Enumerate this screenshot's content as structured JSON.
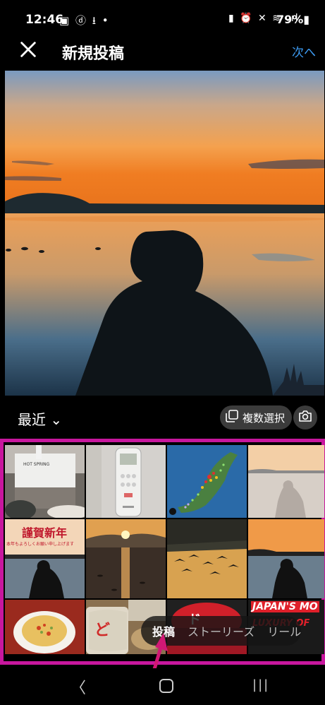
{
  "status_bar": {
    "time": "12:46",
    "left_icons": "▣ ⓓ ⭳ •",
    "right_icons": "▮ ⏰ ✕ ≋ .ıl",
    "battery": "79%▮"
  },
  "header": {
    "title": "新規投稿",
    "next_label": "次へ"
  },
  "album": {
    "label": "最近 ⌄",
    "multi_select_label": "複数選択"
  },
  "grid_texts": {
    "new_year": "謹賀新年",
    "new_year_sub": "本年もよろしくお願い申し上げます",
    "japans_most": "JAPAN'S MO",
    "luxury": "LUXURY OF",
    "hot_spring": "HOT SPRING"
  },
  "tabs": {
    "post": "投稿",
    "story": "ストーリーズ",
    "reel": "リール"
  },
  "nav": {
    "back": "〈",
    "recent": "|||"
  },
  "colors": {
    "accent": "#3d9bf2",
    "highlight_frame": "#c8179e"
  }
}
